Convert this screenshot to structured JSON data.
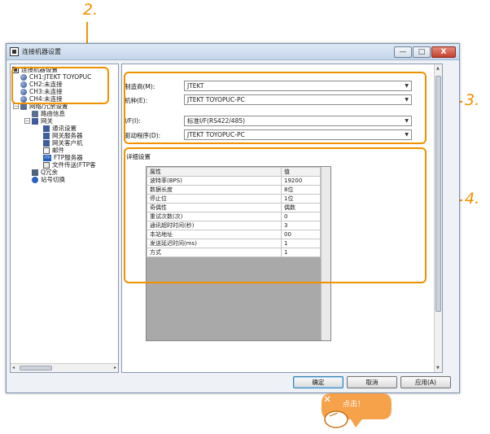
{
  "window": {
    "title": "连接机器设置",
    "minimize": "—",
    "maximize": "□",
    "close": "X"
  },
  "callouts": [
    "2.",
    "3.",
    "4."
  ],
  "tree": {
    "root": "连接机器设置",
    "channels": [
      "CH1:JTEKT TOYOPUC",
      "CH2:未连接",
      "CH3:未连接",
      "CH4:未连接"
    ],
    "network": "网络/冗余设置",
    "routing": "路由信息",
    "gateway": "网关",
    "comm_settings": "通讯设置",
    "gateway_server": "网关服务器",
    "gateway_client": "网关客户机",
    "mail": "邮件",
    "ftp_server": "FTP服务器",
    "file_transfer": "文件传送(FTP客",
    "q_redundancy": "Q冗余",
    "station_switch": "站号切换",
    "ftp_badge": "FTP"
  },
  "form": {
    "manufacturer_label": "制造商(M):",
    "manufacturer_value": "JTEKT",
    "model_label": "机种(E):",
    "model_value": "JTEKT TOYOPUC-PC",
    "if_label": "I/F(I):",
    "if_value": "标准I/F(RS422/485)",
    "driver_label": "驱动程序(D):",
    "driver_value": "JTEKT TOYOPUC-PC"
  },
  "details": {
    "title": "详细设置",
    "headers": [
      "属性",
      "值"
    ],
    "rows": [
      [
        "波特率(BPS)",
        "19200"
      ],
      [
        "数据长度",
        "8位"
      ],
      [
        "停止位",
        "1位"
      ],
      [
        "奇偶性",
        "偶数"
      ],
      [
        "重试次数(次)",
        "0"
      ],
      [
        "通讯超时时间(秒)",
        "3"
      ],
      [
        "本站地址",
        "00"
      ],
      [
        "发送延迟时间(ms)",
        "1"
      ],
      [
        "方式",
        "1"
      ]
    ]
  },
  "buttons": {
    "ok": "确定",
    "cancel": "取消",
    "apply": "应用(A)"
  },
  "click_hint": "点击！",
  "colors": {
    "callout": "#f29100",
    "hint_bg": "#f6a24a"
  }
}
